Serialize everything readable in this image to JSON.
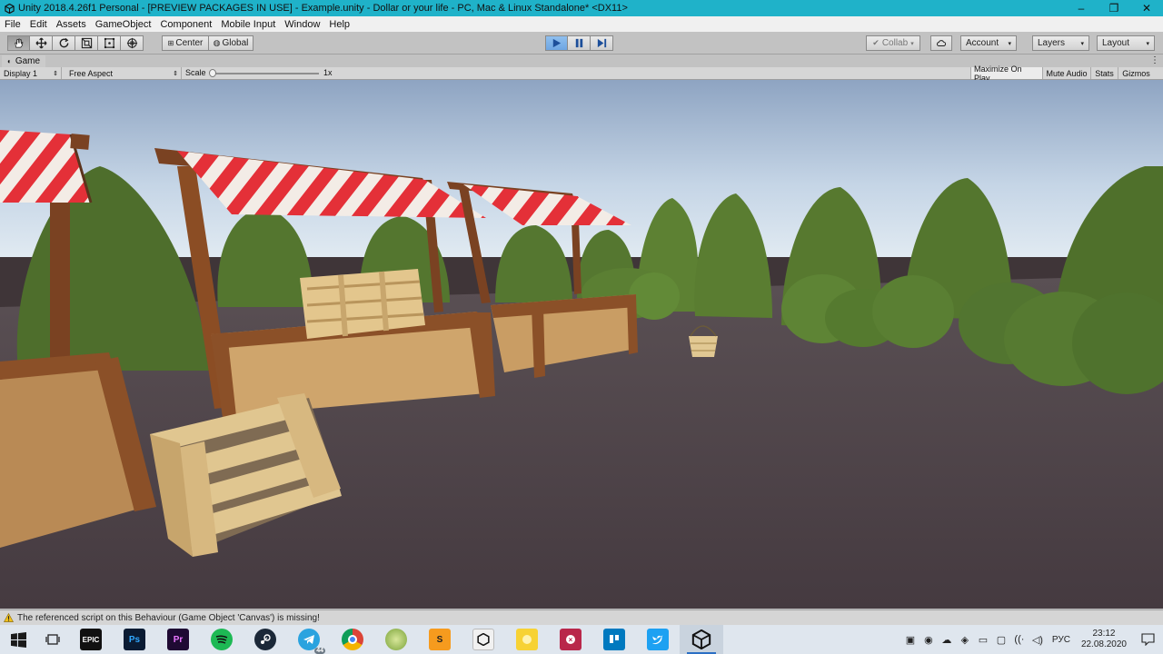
{
  "window": {
    "title": "Unity 2018.4.26f1 Personal - [PREVIEW PACKAGES IN USE] - Example.unity - Dollar or your life - PC, Mac & Linux Standalone* <DX11>",
    "controls": [
      "–",
      "❐",
      "✕"
    ]
  },
  "menu": {
    "items": [
      "File",
      "Edit",
      "Assets",
      "GameObject",
      "Component",
      "Mobile Input",
      "Window",
      "Help"
    ]
  },
  "toolbar": {
    "pivot_label": "Center",
    "space_label": "Global",
    "collab_label": "Collab",
    "account_label": "Account",
    "layers_label": "Layers",
    "layout_label": "Layout"
  },
  "game_tab": {
    "label": "Game",
    "display": "Display 1",
    "aspect": "Free Aspect",
    "scale_label": "Scale",
    "scale_value": "1x",
    "maximize_on_play": "Maximize On Play",
    "mute_audio": "Mute Audio",
    "stats": "Stats",
    "gizmos": "Gizmos"
  },
  "status": {
    "message": "The referenced script on this Behaviour (Game Object 'Canvas') is missing!",
    "icon": "warning-icon"
  },
  "taskbar": {
    "apps": [
      {
        "name": "task-view",
        "label": ""
      },
      {
        "name": "epic-games",
        "label": "EPIC"
      },
      {
        "name": "photoshop",
        "label": "Ps"
      },
      {
        "name": "premiere",
        "label": "Pr"
      },
      {
        "name": "spotify",
        "label": ""
      },
      {
        "name": "steam",
        "label": ""
      },
      {
        "name": "telegram",
        "label": "44"
      },
      {
        "name": "chrome",
        "label": ""
      },
      {
        "name": "game-app",
        "label": ""
      },
      {
        "name": "sublime",
        "label": ""
      },
      {
        "name": "unity-hub",
        "label": ""
      },
      {
        "name": "yellow-app",
        "label": ""
      },
      {
        "name": "red-app",
        "label": ""
      },
      {
        "name": "trello",
        "label": ""
      },
      {
        "name": "twitter",
        "label": ""
      },
      {
        "name": "unity",
        "label": ""
      }
    ],
    "language": "РУС",
    "time": "23:12",
    "date": "22.08.2020"
  },
  "colors": {
    "titlebar": "#1fb2c9",
    "play_active": "#6ea6e3",
    "awning_red": "#e0303a",
    "foliage": "#5a7d2e",
    "ground": "#4a3f44"
  }
}
